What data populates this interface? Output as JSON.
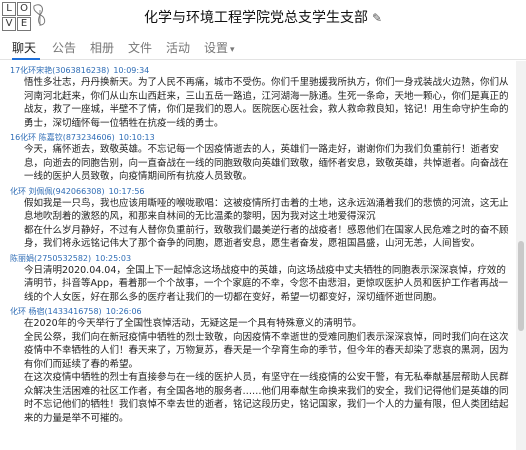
{
  "window": {
    "title": "化学与环境工程学院党总支学生支部"
  },
  "avatar": {
    "tiles": [
      "L",
      "O",
      "V",
      "E"
    ]
  },
  "tabs": [
    {
      "label": "聊天",
      "active": true
    },
    {
      "label": "公告"
    },
    {
      "label": "相册"
    },
    {
      "label": "文件"
    },
    {
      "label": "活动"
    },
    {
      "label": "设置"
    }
  ],
  "messages": [
    {
      "sender": "17化环宋艳(3063816238)",
      "time": "10:09:34",
      "body": [
        "悟性多壮志，丹丹换新天。为了人民不再痛，城市不受伤。你们千里驰援我所执方，你们一身戎装战火边熟，你们从河南河北赶来，你们从山东山西赶来，三山五岳一路追，江河湖海一脉通。生死一条命，天地一颗心，你们是真正的战友，救了一座城，半壁不了情，你们是我们的恩人。医院医心医社会，救人救命救良知，铭记！用生命守护生命的勇士，深切缅怀每一位牺牲在抗疫一线的勇士。"
      ]
    },
    {
      "sender": "16化环 陈嘉钦(873234606)",
      "time": "10:10:13",
      "body": [
        "今天，痛怀逝去，致敬英雄。不忘记每一个因疫情逝去的人，英雄们一路走好，谢谢你们为我们负重前行！逝者安息，向逝去的同胞告别，向一直奋战在一线的同胞致敬向英雄们致敬，缅怀者安息，致敬英雄，共悼逝者。向奋战在一线的医护人员致敬，向疫情期间所有抗疫人员致敬。"
      ]
    },
    {
      "sender": "化环 刘佩佩(942066308)",
      "time": "10:17:56",
      "body": [
        "假如我是一只鸟，我也应该用嘶哑的喉咙歌唱：这被疫情所打击着的土地，这永远汹涌着我们的悲愤的河流，这无止息地吹刮着的激怒的风，和那来自林间的无比温柔的黎明，因为我对这土地爱得深沉",
        "都在什么岁月静好，不过有人替你负重前行，致敬我们最美逆行者的战疫者！感恩他们在国家人民危难之时的奋不顾身，我们将永远铭记伟大了那个奋争的同胞，愿逝者安息，愿生者奋发，愿祖国昌盛，山河无恙，人间皆安。"
      ]
    },
    {
      "sender": "陈丽娟(2750532582)",
      "time": "10:25:03",
      "body": [
        "今日清明2020.04.04，全国上下一起悼念这场战疫中的英雄，向这场战疫中丈夫牺牲的同胞表示深深哀悼，疗效的清明节，抖音等App，看着那一个个故事，一个个家庭的不幸，令您不由悲泪，更惊叹医护人员和医护工作者再战一线的个人女医，好在那么多的医疗者让我们的一切都在变好，希望一切都变好，深切缅怀逝世同胞。"
      ]
    },
    {
      "sender": "化环 杨宿(1433416758)",
      "time": "10:26:06",
      "body": [
        "在2020年的今天举行了全国性哀悼活动，无疑这是一个具有特殊意义的清明节。",
        "全民公祭，我们向在新冠疫情中牺牲的烈士致敬，向因疫情不幸逝世的受难同胞们表示深深哀悼，同时我们向在这次疫情中不幸牺牲的人们！春天来了，万物复苏，春天是一个孕育生命的季节，但今年的春天却染了悲哀的黑洞，因为有你们而延续了春的希望。",
        "在这次疫情中牺牲的烈士有直接参与在一线的医护人员，有坚守在一线疫情的公安干警，有无私奉献基层帮助人民群众解决生活困难的社区工作者，有全国各地的服务者……他们用奉献生命换来我们的安全，我们记得他们是英雄的同时不忘记他们的牺牲！我们哀悼不幸去世的逝者，铭记这段历史，铭记国家，我们一个人的力量有限，但人类团结起来的力量是举不可摧的。"
      ]
    }
  ]
}
